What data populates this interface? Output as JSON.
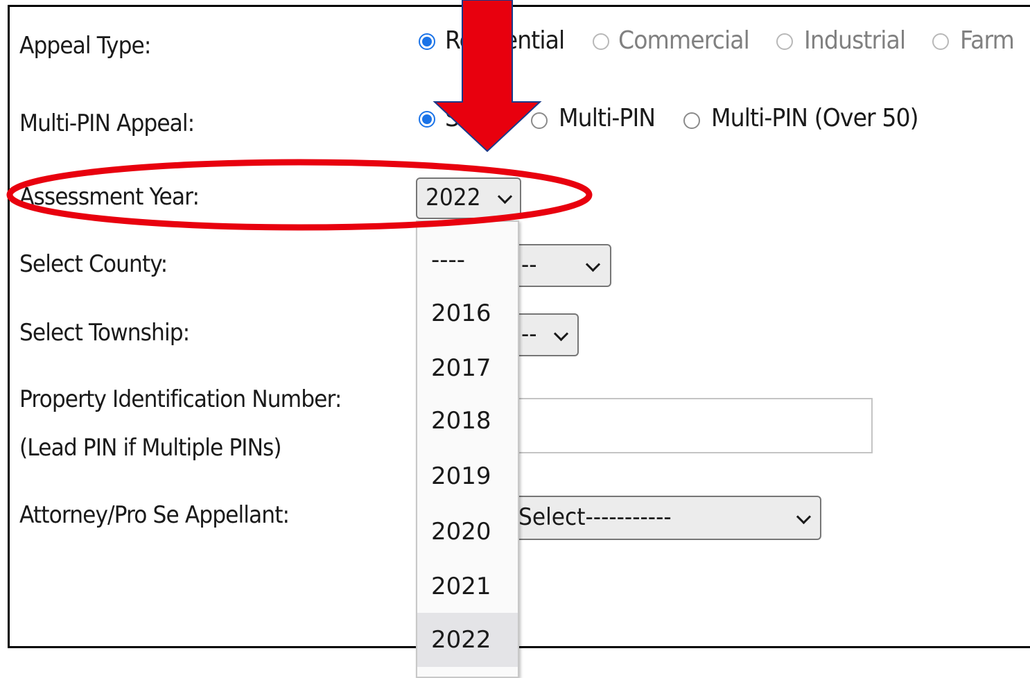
{
  "form": {
    "appeal_type": {
      "label": "Appeal Type:",
      "options": [
        {
          "text": "Residential",
          "checked": true,
          "enabled": true
        },
        {
          "text": "Commercial",
          "checked": false,
          "enabled": false
        },
        {
          "text": "Industrial",
          "checked": false,
          "enabled": false
        },
        {
          "text": "Farm",
          "checked": false,
          "enabled": false
        }
      ]
    },
    "multi_pin": {
      "label": "Multi-PIN Appeal:",
      "options": [
        {
          "text": "Single",
          "checked": true
        },
        {
          "text": "Multi-PIN",
          "checked": false
        },
        {
          "text": "Multi-PIN (Over 50)",
          "checked": false
        }
      ]
    },
    "assessment_year": {
      "label": "Assessment Year:",
      "value": "2022",
      "options": [
        "----",
        "2016",
        "2017",
        "2018",
        "2019",
        "2020",
        "2021",
        "2022"
      ],
      "selected_index": 7
    },
    "county": {
      "label": "Select County:",
      "value": "--"
    },
    "township": {
      "label": "Select Township:",
      "value": "--"
    },
    "pin": {
      "label": "Property Identification Number:",
      "sublabel": "(Lead PIN if Multiple PINs)",
      "value": ""
    },
    "attorney": {
      "label": "Attorney/Pro Se Appellant:",
      "value": "Select-----------"
    }
  },
  "colors": {
    "annotation_red": "#e8000e",
    "radio_blue": "#1a73e8"
  },
  "annotations": {
    "arrow": "red-down-arrow",
    "highlight": "red-ellipse"
  }
}
